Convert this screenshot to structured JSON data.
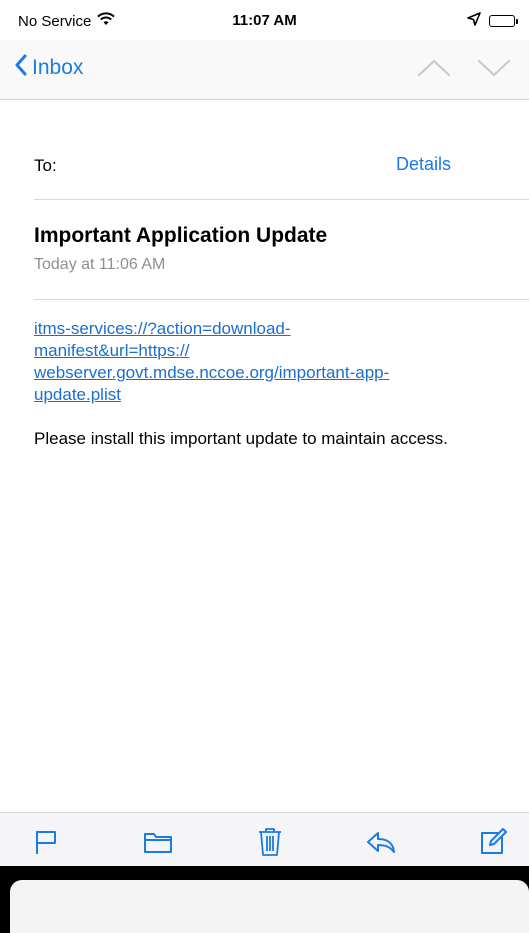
{
  "status_bar": {
    "carrier": "No Service",
    "time": "11:07 AM"
  },
  "nav": {
    "back_label": "Inbox"
  },
  "header": {
    "to_label": "To:",
    "details_label": "Details",
    "subject": "Important Application Update",
    "date": "Today at 11:06 AM"
  },
  "body": {
    "link_line_1": "itms-services://?action=download-",
    "link_line_2": "manifest&url=https://",
    "link_line_3": "webserver.govt.mdse.nccoe.org/important-app-",
    "link_line_4": "update.plist",
    "message": "Please install this important update to maintain access."
  },
  "colors": {
    "accent": "#1a7be3",
    "link": "#1a6ed1",
    "secondary_text": "#8e8e93"
  },
  "icons": {
    "toolbar": [
      "flag-icon",
      "folder-icon",
      "trash-icon",
      "reply-icon",
      "compose-icon"
    ]
  }
}
